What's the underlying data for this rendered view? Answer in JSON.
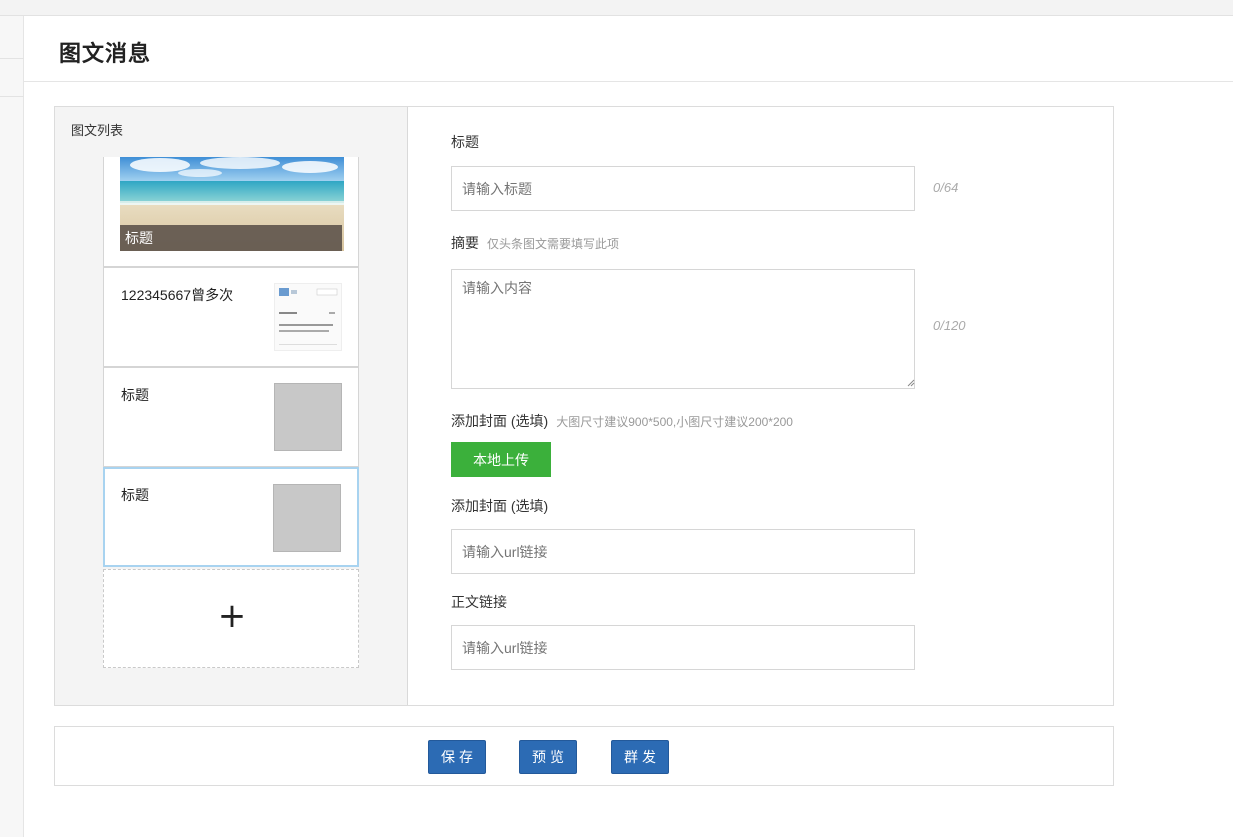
{
  "page": {
    "title": "图文消息"
  },
  "list_panel": {
    "label": "图文列表",
    "cover": {
      "caption": "标题"
    },
    "items": [
      {
        "title": "122345667曾多次"
      },
      {
        "title": "标题"
      },
      {
        "title": "标题"
      }
    ],
    "add_symbol": "+"
  },
  "form": {
    "title": {
      "label": "标题",
      "placeholder": "请输入标题",
      "counter": "0/64"
    },
    "summary": {
      "label": "摘要",
      "hint": "仅头条图文需要填写此项",
      "placeholder": "请输入内容",
      "counter": "0/120"
    },
    "cover_upload": {
      "label": "添加封面 (选填)",
      "hint": "大图尺寸建议900*500,小图尺寸建议200*200",
      "button": "本地上传"
    },
    "cover_url": {
      "label": "添加封面 (选填)",
      "placeholder": "请输入url链接"
    },
    "body_link": {
      "label": "正文链接",
      "placeholder": "请输入url链接"
    }
  },
  "actions": {
    "save": "保存",
    "preview": "预览",
    "send": "群发"
  },
  "colors": {
    "primary": "#2c6bb4",
    "upload": "#3bb03b",
    "selected_border": "#a8d3f0"
  }
}
